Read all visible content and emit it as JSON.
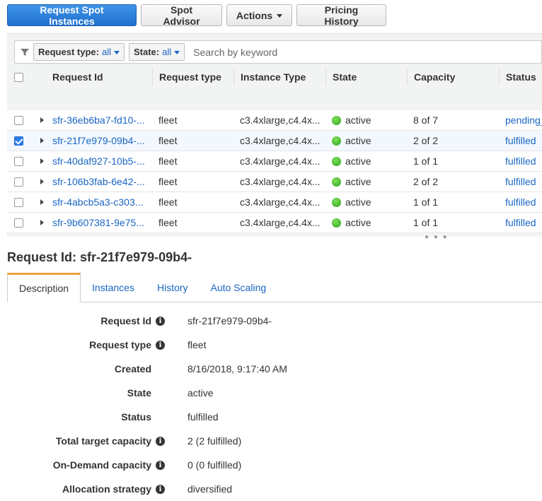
{
  "toolbar": {
    "request_label": "Request Spot Instances",
    "advisor_label": "Spot Advisor",
    "actions_label": "Actions",
    "pricing_label": "Pricing History"
  },
  "filters": {
    "request_type_label": "Request type:",
    "request_type_value": "all",
    "state_label": "State:",
    "state_value": "all",
    "search_placeholder": "Search by keyword"
  },
  "columns": [
    "Request Id",
    "Request type",
    "Instance Type",
    "State",
    "Capacity",
    "Status"
  ],
  "rows": [
    {
      "id": "sfr-36eb6ba7-fd10-...",
      "type": "fleet",
      "instance": "c3.4xlarge,c4.4x...",
      "state": "active",
      "capacity": "8 of 7",
      "status": "pending_",
      "selected": false
    },
    {
      "id": "sfr-21f7e979-09b4-...",
      "type": "fleet",
      "instance": "c3.4xlarge,c4.4x...",
      "state": "active",
      "capacity": "2 of 2",
      "status": "fulfilled",
      "selected": true
    },
    {
      "id": "sfr-40daf927-10b5-...",
      "type": "fleet",
      "instance": "c3.4xlarge,c4.4x...",
      "state": "active",
      "capacity": "1 of 1",
      "status": "fulfilled",
      "selected": false
    },
    {
      "id": "sfr-106b3fab-6e42-...",
      "type": "fleet",
      "instance": "c3.4xlarge,c4.4x...",
      "state": "active",
      "capacity": "2 of 2",
      "status": "fulfilled",
      "selected": false
    },
    {
      "id": "sfr-4abcb5a3-c303...",
      "type": "fleet",
      "instance": "c3.4xlarge,c4.4x...",
      "state": "active",
      "capacity": "1 of 1",
      "status": "fulfilled",
      "selected": false
    },
    {
      "id": "sfr-9b607381-9e75...",
      "type": "fleet",
      "instance": "c3.4xlarge,c4.4x...",
      "state": "active",
      "capacity": "1 of 1",
      "status": "fulfilled",
      "selected": false
    }
  ],
  "detail": {
    "title": "Request Id: sfr-21f7e979-09b4-",
    "tabs": [
      "Description",
      "Instances",
      "History",
      "Auto Scaling"
    ],
    "properties": [
      {
        "label": "Request Id",
        "value": "sfr-21f7e979-09b4-",
        "info": true
      },
      {
        "label": "Request type",
        "value": "fleet",
        "info": true
      },
      {
        "label": "Created",
        "value": "8/16/2018, 9:17:40 AM",
        "info": false
      },
      {
        "label": "State",
        "value": "active",
        "info": false
      },
      {
        "label": "Status",
        "value": "fulfilled",
        "info": false
      },
      {
        "label": "Total target capacity",
        "value": "2 (2 fulfilled)",
        "info": true
      },
      {
        "label": "On-Demand capacity",
        "value": "0 (0 fulfilled)",
        "info": true
      },
      {
        "label": "Allocation strategy",
        "value": "diversified",
        "info": true
      }
    ]
  }
}
